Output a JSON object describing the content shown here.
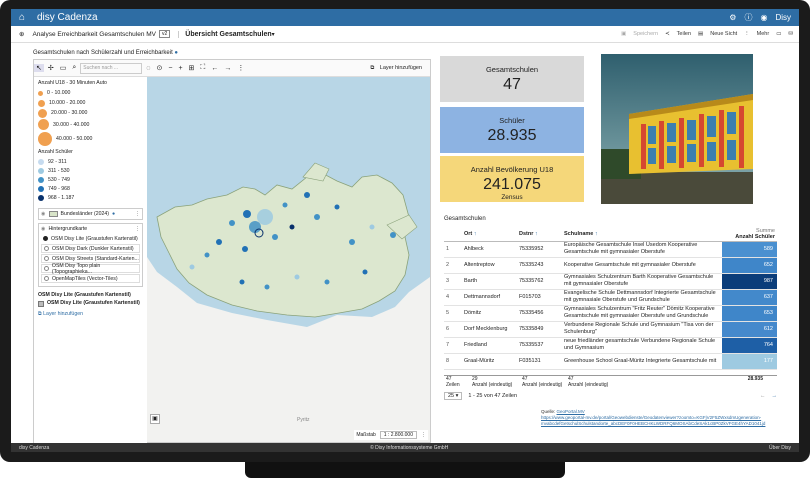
{
  "app": {
    "brand": "disy Cadenza",
    "user": "Disy"
  },
  "toolbar": {
    "workbook": "Analyse Erreichbarkeit Gesamtschulen MV",
    "version": "v2",
    "dashboard": "Übersicht Gesamtschulen",
    "save": "Speichern",
    "share": "Teilen",
    "new_view": "Neue Sicht",
    "more": "Mehr"
  },
  "map": {
    "title": "Gesamtschulen nach Schülerzahl und Erreichbarkeit",
    "search_placeholder": "Suchen nach ...",
    "add_layer": "Layer hinzufügen",
    "scale_label": "Maßstab",
    "scale_value": "1 : 2.800.000",
    "place_label": "Pyritz"
  },
  "legend": {
    "reach_title": "Anzahl U18 - 30 Minuten Auto",
    "reach_items": [
      "0 - 10.000",
      "10.000 - 20.000",
      "20.000 - 30.000",
      "30.000 - 40.000",
      "40.000 - 50.000"
    ],
    "students_title": "Anzahl Schüler",
    "students_items": [
      "92 - 311",
      "311 - 530",
      "530 - 749",
      "749 - 968",
      "968 - 1.187"
    ],
    "students_colors": [
      "#c6dbef",
      "#9ecae1",
      "#4292c6",
      "#2171b5",
      "#08306b"
    ],
    "bundeslaender": "Bundesländer (2024)",
    "background_title": "Hintergrundkarte",
    "background_options": [
      "OSM Disy Lite (Graustufen Kartenstil)",
      "OSM Disy Dark (Dunkler Kartenstil)",
      "OSM Disy Streets (Standard-Karten...",
      "OSM Disy Topo plain (Topographieka...",
      "OpenMapTiles (Vector-Tiles)"
    ],
    "selected_title": "OSM Disy Lite (Graustufen Kartenstil)",
    "selected_box": "OSM Disy Lite (Graustufen Kartenstil)",
    "add_layer": "Layer hinzufügen"
  },
  "kpis": [
    {
      "label": "Gesamtschulen",
      "value": "47",
      "sub": ""
    },
    {
      "label": "Schüler",
      "value": "28.935",
      "sub": ""
    },
    {
      "label": "Anzahl Bevölkerung U18",
      "value": "241.075",
      "sub": "Zensus"
    }
  ],
  "table": {
    "title": "Gesamtschulen",
    "headers": [
      "",
      "Ort",
      "Dstnr",
      "Schulname",
      "Anzahl Schüler"
    ],
    "sum_label": "Summe",
    "rows": [
      {
        "n": "1",
        "ort": "Ahlbeck",
        "dstnr": "75335952",
        "name": "Europäische Gesamtschule Insel Usedom Kooperative Gesamtschule mit gymnasialer Oberstufe",
        "count": "589",
        "color": "#4a90d0"
      },
      {
        "n": "2",
        "ort": "Altentreptow",
        "dstnr": "75335243",
        "name": "Kooperative Gesamtschule mit gymnasialer Oberstufe",
        "count": "652",
        "color": "#3f86c9"
      },
      {
        "n": "3",
        "ort": "Barth",
        "dstnr": "75335762",
        "name": "Gymnasiales Schulzentrum Barth Kooperative Gesamtschule mit gymnasialer Oberstufe",
        "count": "987",
        "color": "#0b3d7a"
      },
      {
        "n": "4",
        "ort": "Dettmannsdorf",
        "dstnr": "F015703",
        "name": "Evangelische Schule Dettmannsdorf Integrierte Gesamtschule mit gymnasiale Oberstufe und Grundschule",
        "count": "637",
        "color": "#4389cb"
      },
      {
        "n": "5",
        "ort": "Dömitz",
        "dstnr": "75335456",
        "name": "Gymnasiales Schulzentrum \"Fritz Reuter\" Dömitz Kooperative Gesamtschule mit gymnasialer Oberstufe und Grundschule",
        "count": "653",
        "color": "#3f86c9"
      },
      {
        "n": "6",
        "ort": "Dorf Mecklenburg",
        "dstnr": "75335849",
        "name": "Verbundene Regionale Schule und Gymnasium \"Tisa von der Schulenburg\"",
        "count": "612",
        "color": "#4589cc"
      },
      {
        "n": "7",
        "ort": "Friedland",
        "dstnr": "75335537",
        "name": "neue friedländer gesamtschule Verbundene Regionale Schule und Gymnasium",
        "count": "764",
        "color": "#1e5fa6"
      },
      {
        "n": "8",
        "ort": "Graal-Müritz",
        "dstnr": "F035131",
        "name": "Greenhouse School Graal-Müritz Integrierte Gesamtschule mit",
        "count": "177",
        "color": "#9ecae1"
      }
    ],
    "footer": {
      "count_rows": "47",
      "rows_label": "Zeilen",
      "ort_count": "29",
      "ort_label": "Anzahl (eindeutig)",
      "dstnr_count": "47",
      "dstnr_label": "Anzahl (eindeutig)",
      "name_count": "47",
      "name_label": "Anzahl (eindeutig)",
      "sum": "28.935"
    },
    "page_size": "25",
    "range": "1 - 25 von 47 Zeilen"
  },
  "source": {
    "label": "Quelle:",
    "portal": "GeoPortal.MV",
    "url1": "https://www.geoportal-mv.de/portal/Geowebdienste/Geodatenviewer?zoomto=KGFjV2F5ZWxsdmUgeneration-",
    "url2": "mvabcdefGetschulSchulstandorte_abcDEF0F0HEBCHKLWDRFQ6MOSAbCdeSAk1cBP0ZkVFGE4hYAD1041jd"
  },
  "footer": {
    "left": "disy Cadenza",
    "center": "© Disy Informationssysteme GmbH",
    "right": "Über Disy"
  }
}
